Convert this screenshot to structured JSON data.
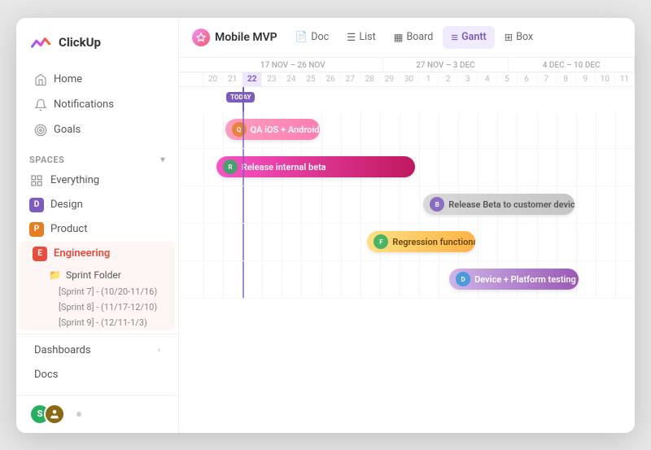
{
  "app": {
    "name": "ClickUp"
  },
  "sidebar": {
    "nav": [
      {
        "id": "home",
        "label": "Home",
        "icon": "home"
      },
      {
        "id": "notifications",
        "label": "Notifications",
        "icon": "bell"
      },
      {
        "id": "goals",
        "label": "Goals",
        "icon": "target"
      }
    ],
    "spaces_label": "Spaces",
    "spaces": [
      {
        "id": "everything",
        "label": "Everything",
        "icon": "grid"
      },
      {
        "id": "design",
        "label": "Design",
        "color": "#7c5cbf",
        "letter": "D"
      },
      {
        "id": "product",
        "label": "Product",
        "color": "#e67e22",
        "letter": "P"
      },
      {
        "id": "engineering",
        "label": "Engineering",
        "color": "#e74c3c",
        "letter": "E",
        "active": true
      }
    ],
    "sprint_folder": "Sprint Folder",
    "sprints": [
      "[Sprint 7] - (10/20-11/16)",
      "[Sprint 8] - (11/17-12/10)",
      "[Sprint 9] - (12/11-1/3)"
    ],
    "bottom_sections": [
      {
        "id": "dashboards",
        "label": "Dashboards"
      },
      {
        "id": "docs",
        "label": "Docs"
      }
    ],
    "user_avatar1": "S",
    "user_avatar2": "U"
  },
  "topbar": {
    "project": "Mobile MVP",
    "tabs": [
      {
        "id": "doc",
        "label": "Doc",
        "icon": "📄"
      },
      {
        "id": "list",
        "label": "List",
        "icon": "☰"
      },
      {
        "id": "board",
        "label": "Board",
        "icon": "▦"
      },
      {
        "id": "gantt",
        "label": "Gantt",
        "icon": "≡",
        "active": true
      },
      {
        "id": "box",
        "label": "Box",
        "icon": "⊞"
      }
    ]
  },
  "gantt": {
    "months": [
      {
        "label": "17 NOV – 26 NOV",
        "span": 10
      },
      {
        "label": "27 NOV – 3 DEC",
        "span": 7
      },
      {
        "label": "4 DEC – 10 DEC",
        "span": 7
      }
    ],
    "days": [
      20,
      21,
      22,
      23,
      24,
      25,
      26,
      27,
      28,
      29,
      30,
      1,
      2,
      3,
      4,
      5,
      6,
      7,
      8,
      9,
      10,
      11
    ],
    "today_day": 22,
    "tasks": [
      {
        "id": "t1",
        "label": "QA iOS + Android",
        "color_from": "#ff7eb3",
        "color_to": "#ff6b6b",
        "start_pct": 10,
        "width_pct": 22,
        "has_avatar": true,
        "avatar_color": "#e67e22"
      },
      {
        "id": "t2",
        "label": "Release internal beta",
        "color_from": "#f953c6",
        "color_to": "#b91d73",
        "start_pct": 8,
        "width_pct": 44,
        "has_avatar": true,
        "avatar_color": "#27ae60"
      },
      {
        "id": "t3",
        "label": "Release Beta to customer devices",
        "color_from": "#e0e0e0",
        "color_to": "#d0d0d0",
        "start_pct": 52,
        "width_pct": 34,
        "has_avatar": true,
        "avatar_color": "#7c5cbf",
        "text_color": "#555"
      },
      {
        "id": "t4",
        "label": "Regression functional testing",
        "color_from": "#ffd89b",
        "color_to": "#ffb347",
        "start_pct": 40,
        "width_pct": 26,
        "has_avatar": true,
        "avatar_color": "#27ae60"
      },
      {
        "id": "t5",
        "label": "Device + Platform testing",
        "color_from": "#c3b1e1",
        "color_to": "#9b59b6",
        "start_pct": 58,
        "width_pct": 30,
        "has_avatar": true,
        "avatar_color": "#3498db"
      }
    ]
  }
}
